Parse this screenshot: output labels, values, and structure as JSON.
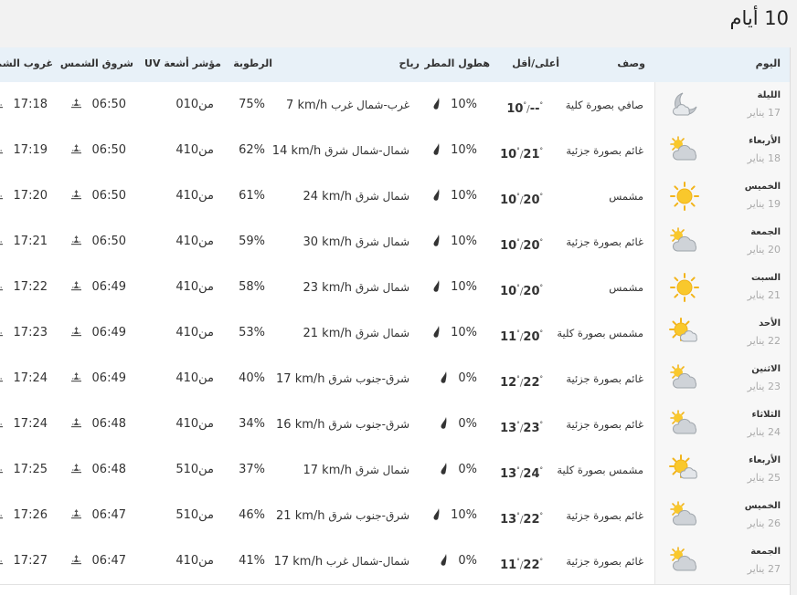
{
  "title": "10 أيام",
  "headers": {
    "day": "اليوم",
    "desc": "وصف",
    "temp": "أعلى/أقل",
    "rain": "هطول المطر",
    "wind": "رياح",
    "humidity": "الرطوبة",
    "uv": "مؤشر أشعة UV",
    "sunrise": "شروق الشمس",
    "sunset": "غروب الشم"
  },
  "rows": [
    {
      "day": "الليلة",
      "date": "17 يناير",
      "icon": "moon-cloud",
      "desc": "صافي بصورة كلية",
      "hi": "--",
      "lo": "10",
      "rain": "10%",
      "wind_dir": "غرب-شمال غرب",
      "wind_speed": "7 km/h",
      "humidity": "75%",
      "uv": "0من10",
      "sunrise": "06:50",
      "sunset": "17:18"
    },
    {
      "day": "الأربعاء",
      "date": "18 يناير",
      "icon": "partly-cloudy",
      "desc": "غائم بصورة جزئية",
      "hi": "21",
      "lo": "10",
      "rain": "10%",
      "wind_dir": "شمال-شمال شرق",
      "wind_speed": "14 km/h",
      "humidity": "62%",
      "uv": "4من10",
      "sunrise": "06:50",
      "sunset": "17:19"
    },
    {
      "day": "الخميس",
      "date": "19 يناير",
      "icon": "sunny",
      "desc": "مشمس",
      "hi": "20",
      "lo": "10",
      "rain": "10%",
      "wind_dir": "شمال شرق",
      "wind_speed": "24 km/h",
      "humidity": "61%",
      "uv": "4من10",
      "sunrise": "06:50",
      "sunset": "17:20"
    },
    {
      "day": "الجمعة",
      "date": "20 يناير",
      "icon": "partly-cloudy",
      "desc": "غائم بصورة جزئية",
      "hi": "20",
      "lo": "10",
      "rain": "10%",
      "wind_dir": "شمال شرق",
      "wind_speed": "30 km/h",
      "humidity": "59%",
      "uv": "4من10",
      "sunrise": "06:50",
      "sunset": "17:21"
    },
    {
      "day": "السبت",
      "date": "21 يناير",
      "icon": "sunny",
      "desc": "مشمس",
      "hi": "20",
      "lo": "10",
      "rain": "10%",
      "wind_dir": "شمال شرق",
      "wind_speed": "23 km/h",
      "humidity": "58%",
      "uv": "4من10",
      "sunrise": "06:49",
      "sunset": "17:22"
    },
    {
      "day": "الأحد",
      "date": "22 يناير",
      "icon": "mostly-sunny",
      "desc": "مشمس بصورة كلية",
      "hi": "20",
      "lo": "11",
      "rain": "10%",
      "wind_dir": "شمال شرق",
      "wind_speed": "21 km/h",
      "humidity": "53%",
      "uv": "4من10",
      "sunrise": "06:49",
      "sunset": "17:23"
    },
    {
      "day": "الاثنين",
      "date": "23 يناير",
      "icon": "partly-cloudy",
      "desc": "غائم بصورة جزئية",
      "hi": "22",
      "lo": "12",
      "rain": "0%",
      "wind_dir": "شرق-جنوب شرق",
      "wind_speed": "17 km/h",
      "humidity": "40%",
      "uv": "4من10",
      "sunrise": "06:49",
      "sunset": "17:24"
    },
    {
      "day": "الثلاثاء",
      "date": "24 يناير",
      "icon": "partly-cloudy",
      "desc": "غائم بصورة جزئية",
      "hi": "23",
      "lo": "13",
      "rain": "0%",
      "wind_dir": "شرق-جنوب شرق",
      "wind_speed": "16 km/h",
      "humidity": "34%",
      "uv": "4من10",
      "sunrise": "06:48",
      "sunset": "17:24"
    },
    {
      "day": "الأربعاء",
      "date": "25 يناير",
      "icon": "mostly-sunny",
      "desc": "مشمس بصورة كلية",
      "hi": "24",
      "lo": "13",
      "rain": "0%",
      "wind_dir": "شمال شرق",
      "wind_speed": "17 km/h",
      "humidity": "37%",
      "uv": "5من10",
      "sunrise": "06:48",
      "sunset": "17:25"
    },
    {
      "day": "الخميس",
      "date": "26 يناير",
      "icon": "partly-cloudy",
      "desc": "غائم بصورة جزئية",
      "hi": "22",
      "lo": "13",
      "rain": "10%",
      "wind_dir": "شرق-جنوب شرق",
      "wind_speed": "21 km/h",
      "humidity": "46%",
      "uv": "5من10",
      "sunrise": "06:47",
      "sunset": "17:26"
    },
    {
      "day": "الجمعة",
      "date": "27 يناير",
      "icon": "partly-cloudy",
      "desc": "غائم بصورة جزئية",
      "hi": "22",
      "lo": "11",
      "rain": "0%",
      "wind_dir": "شمال-شمال غرب",
      "wind_speed": "17 km/h",
      "humidity": "41%",
      "uv": "4من10",
      "sunrise": "06:47",
      "sunset": "17:27"
    }
  ]
}
